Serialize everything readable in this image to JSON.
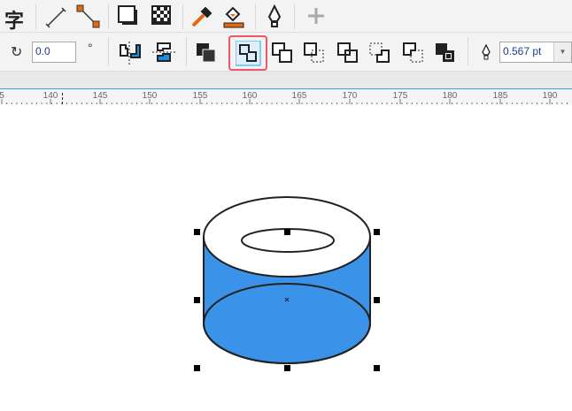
{
  "toolbar_top": {
    "icons": [
      "text-icon",
      "dimension-line-icon",
      "connector-icon",
      "drop-shadow-icon",
      "transparency-icon",
      "eyedropper-icon",
      "interactive-fill-icon",
      "pen-outline-icon",
      "add-icon"
    ],
    "text_glyph": "字"
  },
  "property_bar": {
    "rotation_value": "0.0",
    "degree_symbol": "°",
    "outline_width": "0.567 pt"
  },
  "ruler": {
    "labels": [
      "5",
      "140",
      "145",
      "150",
      "155",
      "160",
      "165",
      "170",
      "175",
      "180",
      "185",
      "190"
    ]
  },
  "colors": {
    "fill": "#3a93e8",
    "highlight": "#f0556a",
    "ruler_line": "#29a3e0"
  }
}
